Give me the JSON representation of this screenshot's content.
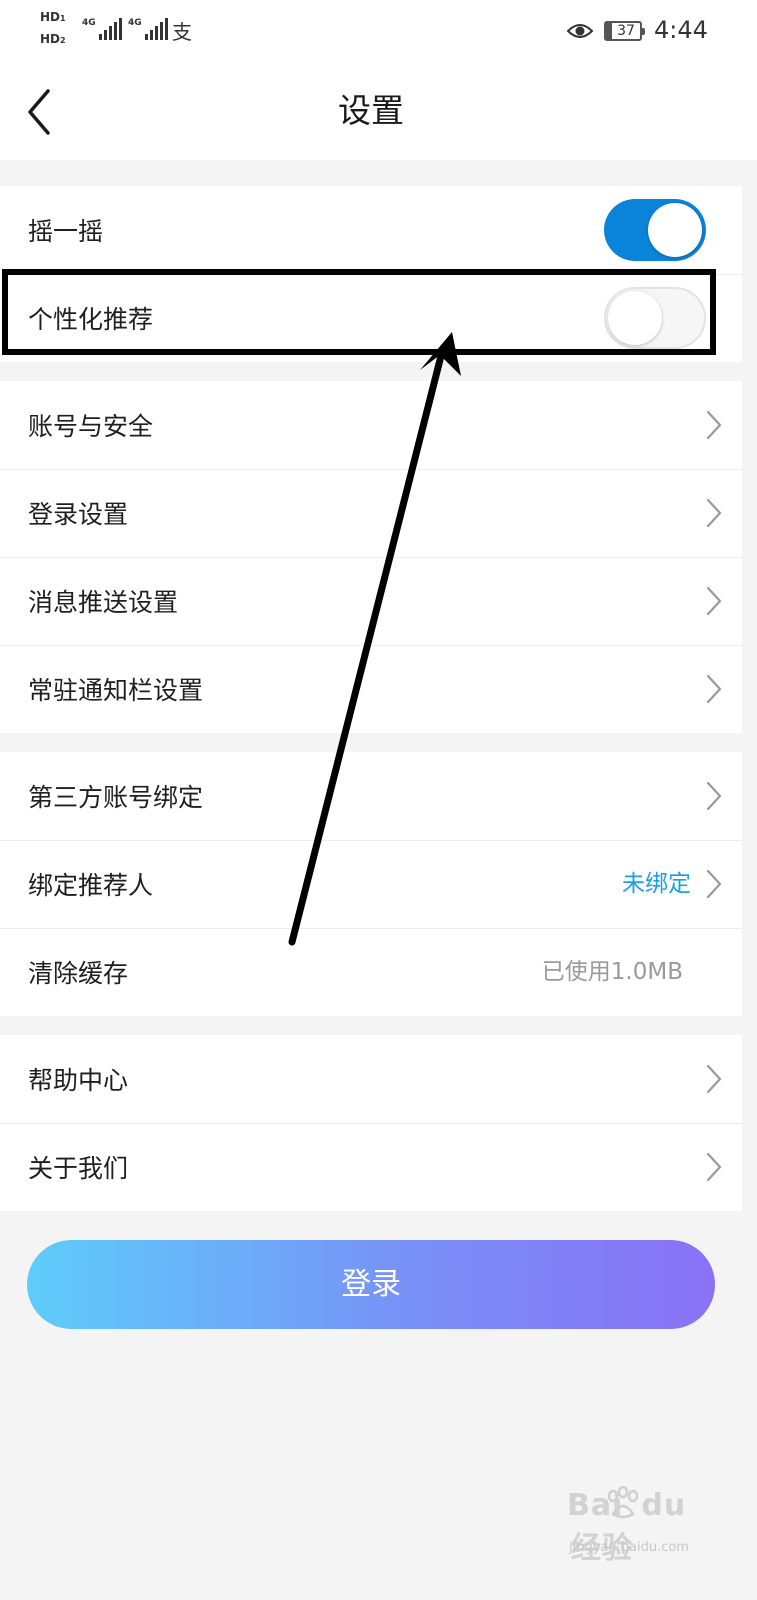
{
  "status_bar": {
    "sim1": "HD",
    "sim1_index": "1",
    "sim2": "HD",
    "sim2_index": "2",
    "network_1": "4G",
    "network_2": "4G",
    "alipay_glyph": "支",
    "battery": "37",
    "time": "4:44"
  },
  "header": {
    "title": "设置"
  },
  "groups": {
    "toggles": {
      "shake": {
        "label": "摇一摇",
        "enabled": true
      },
      "personalized": {
        "label": "个性化推荐",
        "enabled": false
      }
    },
    "account": {
      "items": [
        {
          "label": "账号与安全"
        },
        {
          "label": "登录设置"
        },
        {
          "label": "消息推送设置"
        },
        {
          "label": "常驻通知栏设置"
        }
      ]
    },
    "binding": {
      "third_party": {
        "label": "第三方账号绑定"
      },
      "referrer": {
        "label": "绑定推荐人",
        "value": "未绑定"
      },
      "cache": {
        "label": "清除缓存",
        "value": "已使用1.0MB"
      }
    },
    "help": {
      "items": [
        {
          "label": "帮助中心"
        },
        {
          "label": "关于我们"
        }
      ]
    }
  },
  "login_button": {
    "label": "登录"
  },
  "watermark": {
    "logo_left": "Bai",
    "logo_right": "du",
    "logo_cn": "经验",
    "site": "jingyan.baidu.com"
  },
  "colors": {
    "toggle_on": "#0a84d8",
    "link_blue": "#19a0e6",
    "button_gradient_start": "#5ecdfa",
    "button_gradient_end": "#8a72f6",
    "annotation": "#000000"
  }
}
